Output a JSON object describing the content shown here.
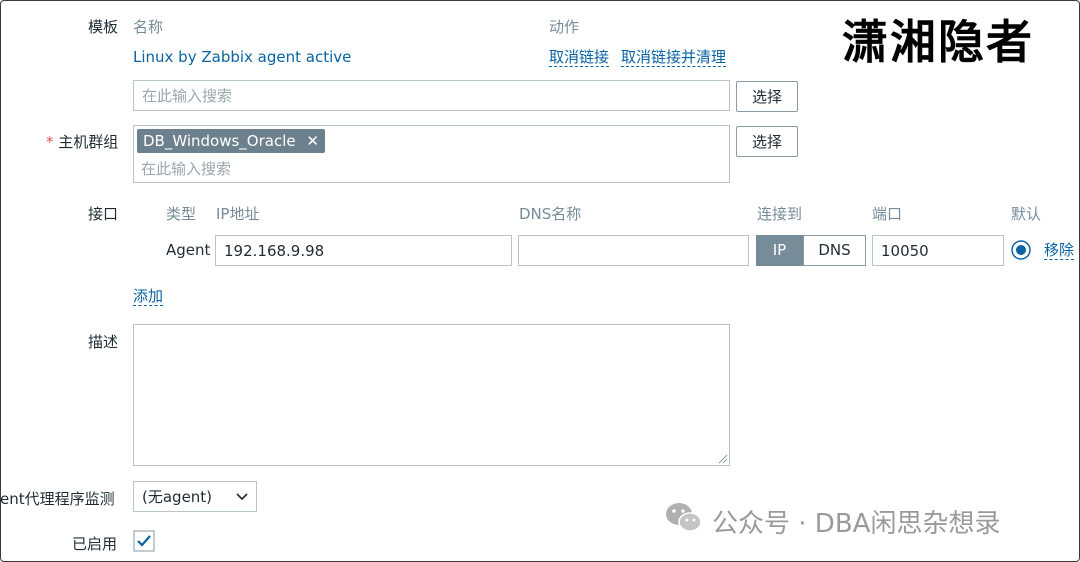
{
  "watermark": {
    "title": "潇湘隐者",
    "source": "公众号 · DBA闲思杂想录"
  },
  "template": {
    "label": "模板",
    "col_name": "名称",
    "col_action": "动作",
    "item_name": "Linux by Zabbix agent active",
    "unlink": "取消链接",
    "unlink_clear": "取消链接并清理",
    "search_placeholder": "在此输入搜索",
    "select_button": "选择"
  },
  "host_group": {
    "required_mark": "*",
    "label": "主机群组",
    "tag": "DB_Windows_Oracle",
    "tag_remove": "✕",
    "search_placeholder": "在此输入搜索",
    "select_button": "选择"
  },
  "interfaces": {
    "label": "接口",
    "headers": {
      "type": "类型",
      "ip": "IP地址",
      "dns": "DNS名称",
      "connect_to": "连接到",
      "port": "端口",
      "default": "默认"
    },
    "row": {
      "type": "Agent",
      "ip": "192.168.9.98",
      "dns": "",
      "connect_ip": "IP",
      "connect_dns": "DNS",
      "connect_selected": "IP",
      "port": "10050",
      "remove": "移除"
    },
    "add": "添加"
  },
  "description": {
    "label": "描述",
    "value": ""
  },
  "monitored_by": {
    "label": "ent代理程序监测",
    "value": "(无agent)"
  },
  "enabled": {
    "label": "已启用",
    "checked": true
  }
}
